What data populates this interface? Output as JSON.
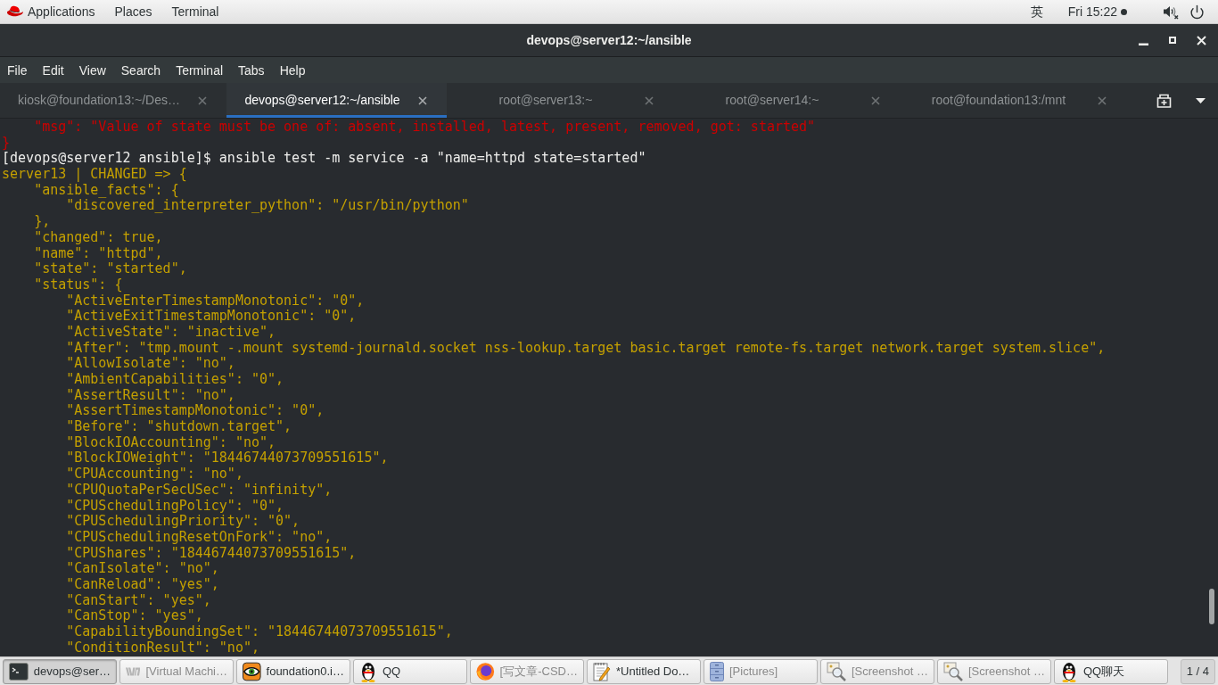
{
  "top_panel": {
    "menus": [
      "Applications",
      "Places",
      "Terminal"
    ],
    "input_method": "英",
    "clock": "Fri 15:22"
  },
  "window": {
    "title": "devops@server12:~/ansible"
  },
  "menu_bar": [
    "File",
    "Edit",
    "View",
    "Search",
    "Terminal",
    "Tabs",
    "Help"
  ],
  "tabs": [
    {
      "label": "kiosk@foundation13:~/Des…",
      "selected": false
    },
    {
      "label": "devops@server12:~/ansible",
      "selected": true
    },
    {
      "label": "root@server13:~",
      "selected": false
    },
    {
      "label": "root@server14:~",
      "selected": false
    },
    {
      "label": "root@foundation13:/mnt",
      "selected": false
    }
  ],
  "terminal": {
    "lines": [
      {
        "kind": "error",
        "text": "    \"msg\": \"Value of state must be one of: absent, installed, latest, present, removed, got: started\""
      },
      {
        "kind": "error",
        "text": "}"
      },
      {
        "kind": "prompt",
        "text": "[devops@server12 ansible]$ ansible test -m service -a \"name=httpd state=started\""
      },
      {
        "kind": "output",
        "text": "server13 | CHANGED => {"
      },
      {
        "kind": "output",
        "text": "    \"ansible_facts\": {"
      },
      {
        "kind": "output",
        "text": "        \"discovered_interpreter_python\": \"/usr/bin/python\""
      },
      {
        "kind": "output",
        "text": "    },"
      },
      {
        "kind": "output",
        "text": "    \"changed\": true,"
      },
      {
        "kind": "output",
        "text": "    \"name\": \"httpd\","
      },
      {
        "kind": "output",
        "text": "    \"state\": \"started\","
      },
      {
        "kind": "output",
        "text": "    \"status\": {"
      },
      {
        "kind": "output",
        "text": "        \"ActiveEnterTimestampMonotonic\": \"0\","
      },
      {
        "kind": "output",
        "text": "        \"ActiveExitTimestampMonotonic\": \"0\","
      },
      {
        "kind": "output",
        "text": "        \"ActiveState\": \"inactive\","
      },
      {
        "kind": "output",
        "text": "        \"After\": \"tmp.mount -.mount systemd-journald.socket nss-lookup.target basic.target remote-fs.target network.target system.slice\","
      },
      {
        "kind": "output",
        "text": "        \"AllowIsolate\": \"no\","
      },
      {
        "kind": "output",
        "text": "        \"AmbientCapabilities\": \"0\","
      },
      {
        "kind": "output",
        "text": "        \"AssertResult\": \"no\","
      },
      {
        "kind": "output",
        "text": "        \"AssertTimestampMonotonic\": \"0\","
      },
      {
        "kind": "output",
        "text": "        \"Before\": \"shutdown.target\","
      },
      {
        "kind": "output",
        "text": "        \"BlockIOAccounting\": \"no\","
      },
      {
        "kind": "output",
        "text": "        \"BlockIOWeight\": \"18446744073709551615\","
      },
      {
        "kind": "output",
        "text": "        \"CPUAccounting\": \"no\","
      },
      {
        "kind": "output",
        "text": "        \"CPUQuotaPerSecUSec\": \"infinity\","
      },
      {
        "kind": "output",
        "text": "        \"CPUSchedulingPolicy\": \"0\","
      },
      {
        "kind": "output",
        "text": "        \"CPUSchedulingPriority\": \"0\","
      },
      {
        "kind": "output",
        "text": "        \"CPUSchedulingResetOnFork\": \"no\","
      },
      {
        "kind": "output",
        "text": "        \"CPUShares\": \"18446744073709551615\","
      },
      {
        "kind": "output",
        "text": "        \"CanIsolate\": \"no\","
      },
      {
        "kind": "output",
        "text": "        \"CanReload\": \"yes\","
      },
      {
        "kind": "output",
        "text": "        \"CanStart\": \"yes\","
      },
      {
        "kind": "output",
        "text": "        \"CanStop\": \"yes\","
      },
      {
        "kind": "output",
        "text": "        \"CapabilityBoundingSet\": \"18446744073709551615\","
      },
      {
        "kind": "output",
        "text": "        \"ConditionResult\": \"no\","
      }
    ]
  },
  "taskbar": {
    "items": [
      {
        "label": "devops@ser…",
        "selected": true,
        "minimized": false
      },
      {
        "label": "[Virtual Machi…",
        "selected": false,
        "minimized": true
      },
      {
        "label": "foundation0.i…",
        "selected": false,
        "minimized": false
      },
      {
        "label": "QQ",
        "selected": false,
        "minimized": false
      },
      {
        "label": "[写文章-CSD…",
        "selected": false,
        "minimized": true
      },
      {
        "label": "*Untitled Do…",
        "selected": false,
        "minimized": false
      },
      {
        "label": "[Pictures]",
        "selected": false,
        "minimized": true
      },
      {
        "label": "[Screenshot …",
        "selected": false,
        "minimized": true
      },
      {
        "label": "[Screenshot …",
        "selected": false,
        "minimized": true
      },
      {
        "label": "QQ聊天",
        "selected": false,
        "minimized": false
      }
    ],
    "workspace": "1 / 4"
  }
}
